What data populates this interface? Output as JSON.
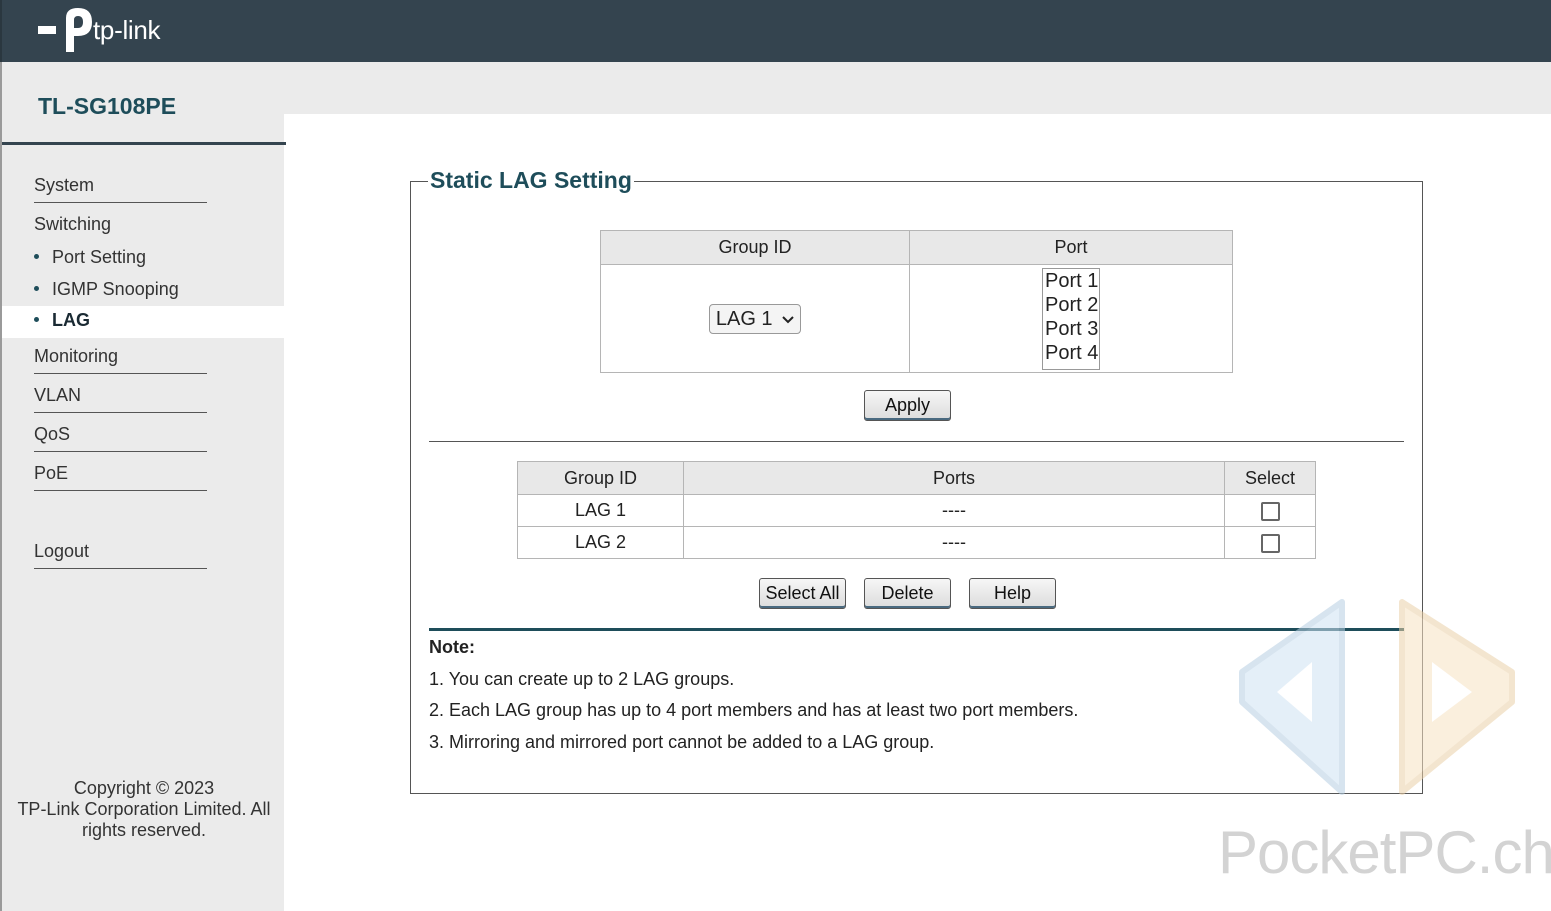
{
  "header": {
    "brand": "tp-link"
  },
  "sidebar": {
    "model": "TL-SG108PE",
    "items": [
      {
        "label": "System"
      },
      {
        "label": "Switching"
      },
      {
        "label": "Monitoring"
      },
      {
        "label": "VLAN"
      },
      {
        "label": "QoS"
      },
      {
        "label": "PoE"
      },
      {
        "label": "Logout"
      }
    ],
    "subitems": [
      {
        "label": "Port Setting"
      },
      {
        "label": "IGMP Snooping"
      },
      {
        "label": "LAG"
      }
    ],
    "copyright": [
      "Copyright © 2023",
      "TP-Link Corporation Limited. All",
      "rights reserved."
    ]
  },
  "main": {
    "title": "Static LAG Setting",
    "config_table": {
      "headers": [
        "Group ID",
        "Port"
      ],
      "group_select": "LAG 1",
      "ports": [
        "Port 1",
        "Port 2",
        "Port 3",
        "Port 4"
      ]
    },
    "apply_label": "Apply",
    "lag_table": {
      "headers": [
        "Group ID",
        "Ports",
        "Select"
      ],
      "rows": [
        {
          "group": "LAG 1",
          "ports": "----"
        },
        {
          "group": "LAG 2",
          "ports": "----"
        }
      ]
    },
    "buttons": {
      "select_all": "Select All",
      "delete": "Delete",
      "help": "Help"
    },
    "note_title": "Note:",
    "notes": [
      "1. You can create up to 2 LAG groups.",
      "2. Each LAG group has up to 4 port members and has at least two port members.",
      "3. Mirroring and mirrored port cannot be added to a LAG group."
    ]
  },
  "watermark": "PocketPC.ch",
  "colors": {
    "header": "#34444f",
    "accent": "#1e4d5a",
    "sidebar": "#ebebeb"
  }
}
